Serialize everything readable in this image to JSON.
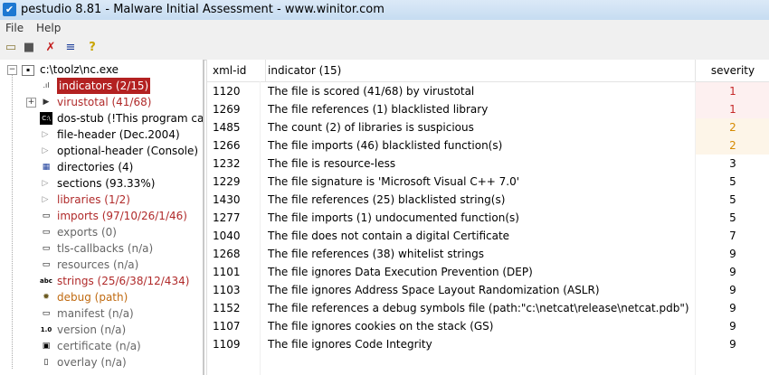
{
  "window": {
    "title": "pestudio 8.81 - Malware Initial Assessment - www.winitor.com"
  },
  "menu": {
    "file": "File",
    "help": "Help"
  },
  "toolbar": {
    "icons": [
      "open-folder-icon",
      "save-icon",
      "delete-icon",
      "list-icon",
      "help-icon"
    ]
  },
  "tree": {
    "root": "c:\\toolz\\nc.exe",
    "items": [
      {
        "label": "indicators (2/15)",
        "style": "sel",
        "icon": "indicators-icon"
      },
      {
        "label": "virustotal (41/68)",
        "style": "red",
        "icon": "virustotal-icon"
      },
      {
        "label": "dos-stub (!This program can",
        "style": "",
        "icon": "dos-stub-icon"
      },
      {
        "label": "file-header (Dec.2004)",
        "style": "",
        "icon": "file-header-icon"
      },
      {
        "label": "optional-header (Console)",
        "style": "",
        "icon": "optional-header-icon"
      },
      {
        "label": "directories (4)",
        "style": "",
        "icon": "directories-icon"
      },
      {
        "label": "sections (93.33%)",
        "style": "",
        "icon": "sections-icon"
      },
      {
        "label": "libraries (1/2)",
        "style": "red",
        "icon": "libraries-icon"
      },
      {
        "label": "imports (97/10/26/1/46)",
        "style": "red",
        "icon": "imports-icon"
      },
      {
        "label": "exports (0)",
        "style": "gray",
        "icon": "exports-icon"
      },
      {
        "label": "tls-callbacks (n/a)",
        "style": "gray",
        "icon": "tls-callbacks-icon"
      },
      {
        "label": "resources (n/a)",
        "style": "gray",
        "icon": "resources-icon"
      },
      {
        "label": "strings (25/6/38/12/434)",
        "style": "red",
        "icon": "strings-icon"
      },
      {
        "label": "debug (path)",
        "style": "orange",
        "icon": "debug-icon"
      },
      {
        "label": "manifest (n/a)",
        "style": "gray",
        "icon": "manifest-icon"
      },
      {
        "label": "version (n/a)",
        "style": "gray",
        "icon": "version-icon"
      },
      {
        "label": "certificate (n/a)",
        "style": "gray",
        "icon": "certificate-icon"
      },
      {
        "label": "overlay (n/a)",
        "style": "gray",
        "icon": "overlay-icon"
      }
    ]
  },
  "table": {
    "headers": {
      "xmlid": "xml-id",
      "indicator": "indicator (15)",
      "severity": "severity"
    },
    "rows": [
      {
        "id": "1120",
        "text": "The file is scored (41/68) by virustotal",
        "sev": "1"
      },
      {
        "id": "1269",
        "text": "The file references (1) blacklisted library",
        "sev": "1"
      },
      {
        "id": "1485",
        "text": "The count (2) of libraries is suspicious",
        "sev": "2"
      },
      {
        "id": "1266",
        "text": "The file imports (46) blacklisted function(s)",
        "sev": "2"
      },
      {
        "id": "1232",
        "text": "The file is resource-less",
        "sev": "3"
      },
      {
        "id": "1229",
        "text": "The file signature is 'Microsoft Visual C++ 7.0'",
        "sev": "5"
      },
      {
        "id": "1430",
        "text": "The file references (25) blacklisted string(s)",
        "sev": "5"
      },
      {
        "id": "1277",
        "text": "The file imports (1) undocumented function(s)",
        "sev": "5"
      },
      {
        "id": "1040",
        "text": "The file does not contain a digital Certificate",
        "sev": "7"
      },
      {
        "id": "1268",
        "text": "The file references (38) whitelist strings",
        "sev": "9"
      },
      {
        "id": "1101",
        "text": "The file ignores Data Execution Prevention (DEP)",
        "sev": "9"
      },
      {
        "id": "1103",
        "text": "The file ignores Address Space Layout Randomization (ASLR)",
        "sev": "9"
      },
      {
        "id": "1152",
        "text": "The file references a debug symbols file (path:\"c:\\netcat\\release\\netcat.pdb\")",
        "sev": "9"
      },
      {
        "id": "1107",
        "text": "The file ignores cookies on the stack (GS)",
        "sev": "9"
      },
      {
        "id": "1109",
        "text": "The file ignores Code Integrity",
        "sev": "9"
      }
    ]
  },
  "colors": {
    "selected": "#b32121",
    "red": "#b02a2a",
    "orange": "#c06a10",
    "sev1": "#c62828",
    "sev2": "#d68a00"
  }
}
